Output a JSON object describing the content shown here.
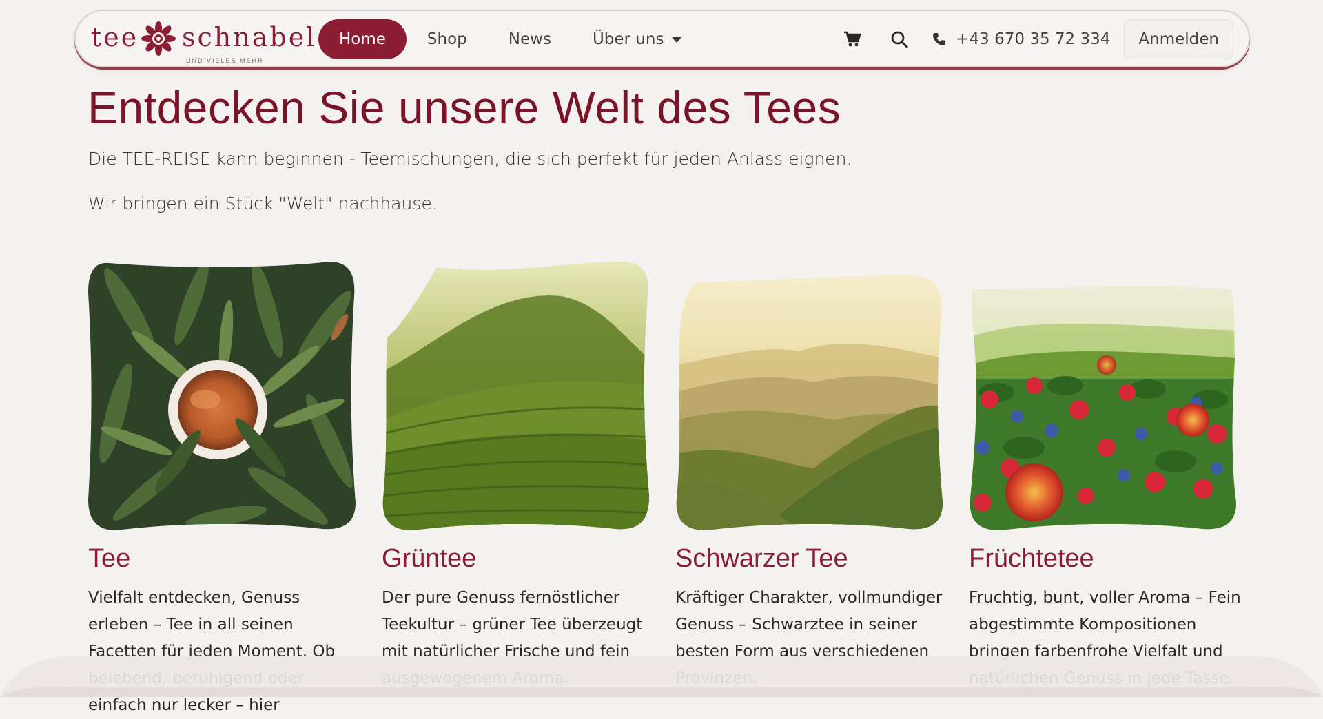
{
  "brand": {
    "word1": "tee",
    "word2": "schnabel",
    "tagline": "UND VIELES MEHR"
  },
  "nav": {
    "items": [
      {
        "label": "Home"
      },
      {
        "label": "Shop"
      },
      {
        "label": "News"
      },
      {
        "label": "Über uns"
      }
    ],
    "phone": "+43 670 35 72 334",
    "login": "Anmelden",
    "icons": [
      "cart-icon",
      "search-icon",
      "phone-icon",
      "chevron-down-icon"
    ]
  },
  "hero": {
    "title": "Entdecken Sie unsere Welt des Tees",
    "line1": "Die TEE-REISE kann beginnen - Teemischungen, die sich perfekt für jeden Anlass eignen.",
    "line2": "Wir bringen ein Stück \"Welt\" nachhause."
  },
  "cards": [
    {
      "title": "Tee",
      "text": "Vielfalt entdecken, Genuss erleben – Tee in all seinen Facetten für jeden Moment. Ob belebend, beruhigend oder einfach nur lecker – hier"
    },
    {
      "title": "Grüntee",
      "text": "Der pure Genuss fernöstlicher Teekultur – grüner Tee überzeugt mit natürlicher Frische und fein ausgewogenem Aroma."
    },
    {
      "title": "Schwarzer Tee",
      "text": "Kräftiger Charakter, vollmundiger Genuss – Schwarztee in seiner besten Form aus verschiedenen Provinzen."
    },
    {
      "title": "Früchtetee",
      "text": "Fruchtig, bunt, voller Aroma – Fein abgestimmte Kompositionen bringen farbenfrohe Vielfalt und natürlichen Genuss in jede Tasse."
    }
  ],
  "colors": {
    "brand": "#8b1e35",
    "title": "#7a1428",
    "background": "#f4f2f1"
  }
}
